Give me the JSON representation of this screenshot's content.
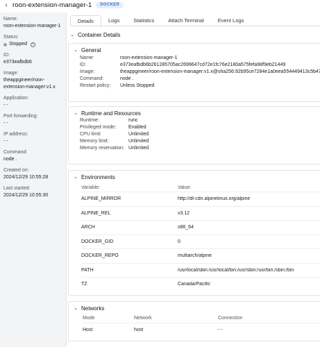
{
  "header": {
    "title": "roon-extension-manager-1",
    "badge": "DOCKER"
  },
  "sidebar": {
    "name_label": "Name:",
    "name_value": "roon-extension-manager-1",
    "status_label": "Status:",
    "status_value": "Stopped",
    "id_label": "ID:",
    "id_value": "e373eafbdb6",
    "image_label": "Image:",
    "image_value": "theappgineer/roon-extension-manager:v1.x",
    "application_label": "Application:",
    "application_value": "- -",
    "port_label": "Port forwarding:",
    "port_value": "- -",
    "ip_label": "IP address:",
    "ip_value": "- -",
    "command_label": "Command:",
    "command_value": "node .",
    "created_label": "Created on:",
    "created_value": "2024/12/29 10:55:28",
    "started_label": "Last started:",
    "started_value": "2024/12/29 10:55:30"
  },
  "tabs": [
    "Details",
    "Logs",
    "Statistics",
    "Attach Terminal",
    "Event Logs"
  ],
  "main": {
    "container_details": "Container Details",
    "general": {
      "title": "General",
      "rows": [
        {
          "k": "Name:",
          "v": "roon-extension-manager-1"
        },
        {
          "k": "ID:",
          "v": "e373eafbdb6b261285705ac2699647cd72e1fc76e2180a575fefa98f9eb21449"
        },
        {
          "k": "Image:",
          "v": "theappgineer/roon-extension-manager:v1.x@sha256:92b95ce7284e1a0eea554449413c5b47f6"
        },
        {
          "k": "Command:",
          "v": "node ."
        },
        {
          "k": "Restart policy:",
          "v": "Unless Stopped"
        }
      ]
    },
    "runtime": {
      "title": "Runtime and Resources",
      "rows": [
        {
          "k": "Runtime:",
          "v": "runc"
        },
        {
          "k": "Privileged mode:",
          "v": "Enabled"
        },
        {
          "k": "CPU limit:",
          "v": "Unlimited"
        },
        {
          "k": "Memory limit:",
          "v": "Unlimited"
        },
        {
          "k": "Memory reservation:",
          "v": "Unlimited"
        }
      ]
    },
    "environments": {
      "title": "Environments",
      "col_variable": "Variable:",
      "col_value": "Value:",
      "rows": [
        {
          "k": "ALPINE_MIRROR",
          "v": "http://dl-cdn.alpinelinux.org/alpine"
        },
        {
          "k": "ALPINE_REL",
          "v": "v3.12"
        },
        {
          "k": "ARCH",
          "v": "x86_64"
        },
        {
          "k": "DOCKER_GID",
          "v": "0"
        },
        {
          "k": "DOCKER_REPO",
          "v": "multiarch/alpine"
        },
        {
          "k": "PATH",
          "v": "/usr/local/sbin:/usr/local/bin:/usr/sbin:/usr/bin:/sbin:/bin"
        },
        {
          "k": "TZ",
          "v": "Canada/Pacific"
        }
      ]
    },
    "networks": {
      "title": "Networks",
      "col_mode": "Mode",
      "col_network": "Network",
      "col_connection": "Connection",
      "rows": [
        {
          "mode": "Host",
          "network": "host",
          "connection": "- -"
        }
      ]
    }
  }
}
